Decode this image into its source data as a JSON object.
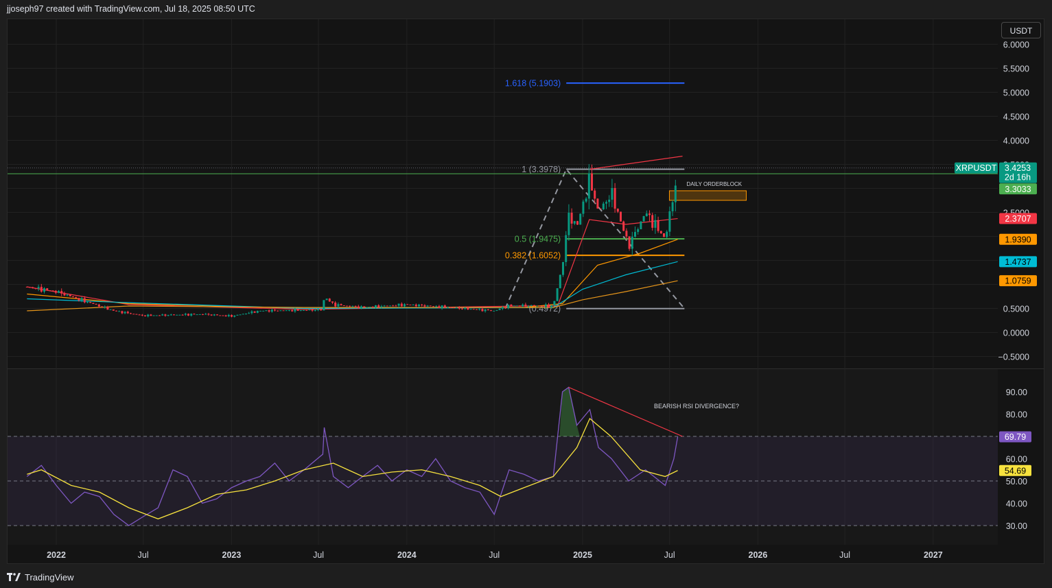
{
  "header": {
    "credit": "jjoseph97 created with TradingView.com, Jul 18, 2025 08:50 UTC"
  },
  "currency_button": "USDT",
  "footer": {
    "brand": "TradingView"
  },
  "chart_data": {
    "type": "candlestick",
    "symbol": "XRPUSDT",
    "price_axis": {
      "ticks": [
        "6.0000",
        "5.5000",
        "5.0000",
        "4.5000",
        "4.0000",
        "3.5000",
        "2.5000",
        "0.5000",
        "0.0000",
        "−0.5000"
      ],
      "tick_values": [
        6.0,
        5.5,
        5.0,
        4.5,
        4.0,
        3.5,
        2.5,
        0.5,
        0.0,
        -0.5
      ],
      "range": [
        -0.5,
        6.0
      ]
    },
    "time_axis": {
      "labels": [
        "2022",
        "Jul",
        "2023",
        "Jul",
        "2024",
        "Jul",
        "2025",
        "Jul",
        "2026",
        "Jul",
        "2027"
      ],
      "bold": [
        true,
        false,
        true,
        false,
        true,
        false,
        true,
        false,
        true,
        false,
        true
      ]
    },
    "price_labels": [
      {
        "text": "XRPUSDT",
        "value": 3.4253,
        "color": "#089981",
        "kind": "symbol"
      },
      {
        "text": "3.4253",
        "value": 3.4253,
        "color": "#089981",
        "sub": "2d 16h"
      },
      {
        "text": "3.3033",
        "value": 3.3033,
        "color": "#4caf50"
      },
      {
        "text": "2.3707",
        "value": 2.3707,
        "color": "#f23645"
      },
      {
        "text": "1.9390",
        "value": 1.939,
        "color": "#ff9800"
      },
      {
        "text": "1.4737",
        "value": 1.4737,
        "color": "#00bcd4"
      },
      {
        "text": "1.0759",
        "value": 1.0759,
        "color": "#ff9800"
      }
    ],
    "fib_levels": [
      {
        "label": "1.618 (5.1903)",
        "value": 5.1903,
        "color": "#2962ff"
      },
      {
        "label": "1 (3.3978)",
        "value": 3.3978,
        "color": "#9598a1"
      },
      {
        "label": "0.5 (1.9475)",
        "value": 1.9475,
        "color": "#4caf50"
      },
      {
        "label": "0.382 (1.6052)",
        "value": 1.6052,
        "color": "#ff9800"
      },
      {
        "label": "(0.4972)",
        "value": 0.4972,
        "color": "#9598a1"
      }
    ],
    "annotations": [
      {
        "text": "DAILY ORDERBLOCK"
      },
      {
        "text": "BEARISH RSI DIVERGENCE?"
      }
    ],
    "orderblock": {
      "low": 2.75,
      "high": 2.95
    },
    "horizontal_line": {
      "value": 3.3033,
      "color": "#4caf50"
    },
    "price_line": {
      "value": 3.4253
    },
    "key_prices": [
      {
        "date": "2021-11-01",
        "price": 0.95
      },
      {
        "date": "2022-01-01",
        "price": 0.85
      },
      {
        "date": "2022-05-01",
        "price": 0.45
      },
      {
        "date": "2022-07-01",
        "price": 0.35
      },
      {
        "date": "2022-11-01",
        "price": 0.38
      },
      {
        "date": "2023-01-01",
        "price": 0.34
      },
      {
        "date": "2023-03-01",
        "price": 0.45
      },
      {
        "date": "2023-07-10",
        "price": 0.47
      },
      {
        "date": "2023-07-13",
        "price": 0.75
      },
      {
        "date": "2023-08-01",
        "price": 0.58
      },
      {
        "date": "2023-10-01",
        "price": 0.52
      },
      {
        "date": "2024-01-01",
        "price": 0.58
      },
      {
        "date": "2024-04-01",
        "price": 0.52
      },
      {
        "date": "2024-07-01",
        "price": 0.45
      },
      {
        "date": "2024-08-01",
        "price": 0.56
      },
      {
        "date": "2024-11-01",
        "price": 0.55
      },
      {
        "date": "2024-11-20",
        "price": 1.4
      },
      {
        "date": "2024-12-03",
        "price": 2.45
      },
      {
        "date": "2024-12-20",
        "price": 2.2
      },
      {
        "date": "2025-01-16",
        "price": 3.2
      },
      {
        "date": "2025-02-03",
        "price": 2.5
      },
      {
        "date": "2025-03-02",
        "price": 2.9
      },
      {
        "date": "2025-04-07",
        "price": 1.8
      },
      {
        "date": "2025-05-12",
        "price": 2.5
      },
      {
        "date": "2025-06-22",
        "price": 1.95
      },
      {
        "date": "2025-07-10",
        "price": 2.9
      },
      {
        "date": "2025-07-18",
        "price": 3.43
      }
    ],
    "ma_lines": [
      {
        "color": "#f23645",
        "points": [
          [
            "2021-11-01",
            0.95
          ],
          [
            "2022-06-01",
            0.58
          ],
          [
            "2023-06-01",
            0.48
          ],
          [
            "2024-09-01",
            0.55
          ],
          [
            "2024-11-10",
            0.55
          ],
          [
            "2025-01-15",
            2.35
          ],
          [
            "2025-04-01",
            2.25
          ],
          [
            "2025-07-18",
            2.3707
          ]
        ]
      },
      {
        "color": "#ff9800",
        "points": [
          [
            "2021-11-01",
            0.8
          ],
          [
            "2022-06-01",
            0.6
          ],
          [
            "2023-06-01",
            0.5
          ],
          [
            "2024-09-01",
            0.52
          ],
          [
            "2024-11-20",
            0.6
          ],
          [
            "2025-02-01",
            1.4
          ],
          [
            "2025-05-01",
            1.65
          ],
          [
            "2025-07-18",
            1.939
          ]
        ]
      },
      {
        "color": "#00bcd4",
        "points": [
          [
            "2021-11-01",
            0.7
          ],
          [
            "2022-06-01",
            0.62
          ],
          [
            "2023-06-01",
            0.5
          ],
          [
            "2024-11-01",
            0.52
          ],
          [
            "2025-01-01",
            0.9
          ],
          [
            "2025-04-01",
            1.2
          ],
          [
            "2025-07-18",
            1.4737
          ]
        ]
      },
      {
        "color": "#e6951a",
        "points": [
          [
            "2021-11-01",
            0.45
          ],
          [
            "2022-06-01",
            0.55
          ],
          [
            "2023-06-01",
            0.52
          ],
          [
            "2024-11-01",
            0.52
          ],
          [
            "2025-01-01",
            0.68
          ],
          [
            "2025-04-01",
            0.85
          ],
          [
            "2025-07-18",
            1.0759
          ]
        ]
      }
    ],
    "fib_drawing": {
      "start": {
        "date": "2024-11-01",
        "price": 0.4972
      },
      "end": {
        "date": "2024-11-28",
        "price": 3.3978
      },
      "extend_to": "2025-08-01",
      "retrace_end": {
        "date": "2025-08-01",
        "price": 0.4972
      }
    },
    "trendline_price": [
      {
        "date": "2025-01-16",
        "price": 3.3978
      },
      {
        "date": "2025-07-28",
        "price": 3.67
      }
    ],
    "rsi": {
      "ticks": [
        "90.00",
        "80.00",
        "60.00",
        "50.00",
        "40.00",
        "30.00"
      ],
      "tick_values": [
        90,
        80,
        60,
        50,
        40,
        30
      ],
      "bands": [
        70,
        50,
        30
      ],
      "current": {
        "text": "69.79",
        "value": 69.79,
        "color": "#7e57c2"
      },
      "signal": {
        "text": "54.69",
        "value": 54.69,
        "color": "#f7e23e"
      },
      "rsi_points": [
        [
          "2021-11-01",
          52
        ],
        [
          "2021-12-01",
          57
        ],
        [
          "2022-01-01",
          48
        ],
        [
          "2022-02-01",
          40
        ],
        [
          "2022-03-01",
          45
        ],
        [
          "2022-04-01",
          43
        ],
        [
          "2022-05-01",
          35
        ],
        [
          "2022-06-01",
          30
        ],
        [
          "2022-07-01",
          34
        ],
        [
          "2022-08-01",
          38
        ],
        [
          "2022-09-01",
          55
        ],
        [
          "2022-10-01",
          52
        ],
        [
          "2022-11-01",
          40
        ],
        [
          "2022-12-01",
          42
        ],
        [
          "2023-01-01",
          47
        ],
        [
          "2023-02-01",
          50
        ],
        [
          "2023-03-01",
          52
        ],
        [
          "2023-04-01",
          58
        ],
        [
          "2023-05-01",
          50
        ],
        [
          "2023-06-01",
          55
        ],
        [
          "2023-07-10",
          62
        ],
        [
          "2023-07-13",
          74
        ],
        [
          "2023-08-01",
          52
        ],
        [
          "2023-09-01",
          47
        ],
        [
          "2023-10-01",
          52
        ],
        [
          "2023-11-01",
          57
        ],
        [
          "2023-12-01",
          50
        ],
        [
          "2024-01-01",
          55
        ],
        [
          "2024-02-01",
          52
        ],
        [
          "2024-03-01",
          60
        ],
        [
          "2024-04-01",
          50
        ],
        [
          "2024-05-01",
          47
        ],
        [
          "2024-06-01",
          45
        ],
        [
          "2024-07-01",
          35
        ],
        [
          "2024-08-01",
          55
        ],
        [
          "2024-09-01",
          53
        ],
        [
          "2024-10-01",
          50
        ],
        [
          "2024-11-01",
          52
        ],
        [
          "2024-11-20",
          90
        ],
        [
          "2024-12-03",
          92
        ],
        [
          "2024-12-20",
          75
        ],
        [
          "2025-01-16",
          82
        ],
        [
          "2025-02-03",
          65
        ],
        [
          "2025-03-02",
          60
        ],
        [
          "2025-04-07",
          50
        ],
        [
          "2025-05-12",
          55
        ],
        [
          "2025-06-22",
          48
        ],
        [
          "2025-07-10",
          60
        ],
        [
          "2025-07-18",
          69.79
        ]
      ],
      "signal_points": [
        [
          "2021-11-01",
          53
        ],
        [
          "2021-12-01",
          55
        ],
        [
          "2022-02-01",
          48
        ],
        [
          "2022-04-01",
          45
        ],
        [
          "2022-06-01",
          38
        ],
        [
          "2022-08-01",
          33
        ],
        [
          "2022-10-01",
          38
        ],
        [
          "2022-12-01",
          44
        ],
        [
          "2023-02-01",
          46
        ],
        [
          "2023-04-01",
          50
        ],
        [
          "2023-06-01",
          55
        ],
        [
          "2023-08-01",
          58
        ],
        [
          "2023-10-01",
          52
        ],
        [
          "2023-12-01",
          54
        ],
        [
          "2024-02-01",
          55
        ],
        [
          "2024-04-01",
          52
        ],
        [
          "2024-06-01",
          48
        ],
        [
          "2024-07-15",
          43
        ],
        [
          "2024-09-01",
          47
        ],
        [
          "2024-11-01",
          52
        ],
        [
          "2024-12-20",
          65
        ],
        [
          "2025-01-16",
          78
        ],
        [
          "2025-03-01",
          70
        ],
        [
          "2025-05-01",
          55
        ],
        [
          "2025-06-22",
          52
        ],
        [
          "2025-07-18",
          54.69
        ]
      ],
      "divergence_line": [
        {
          "date": "2024-12-03",
          "value": 92
        },
        {
          "date": "2025-07-28",
          "value": 70
        }
      ]
    }
  }
}
